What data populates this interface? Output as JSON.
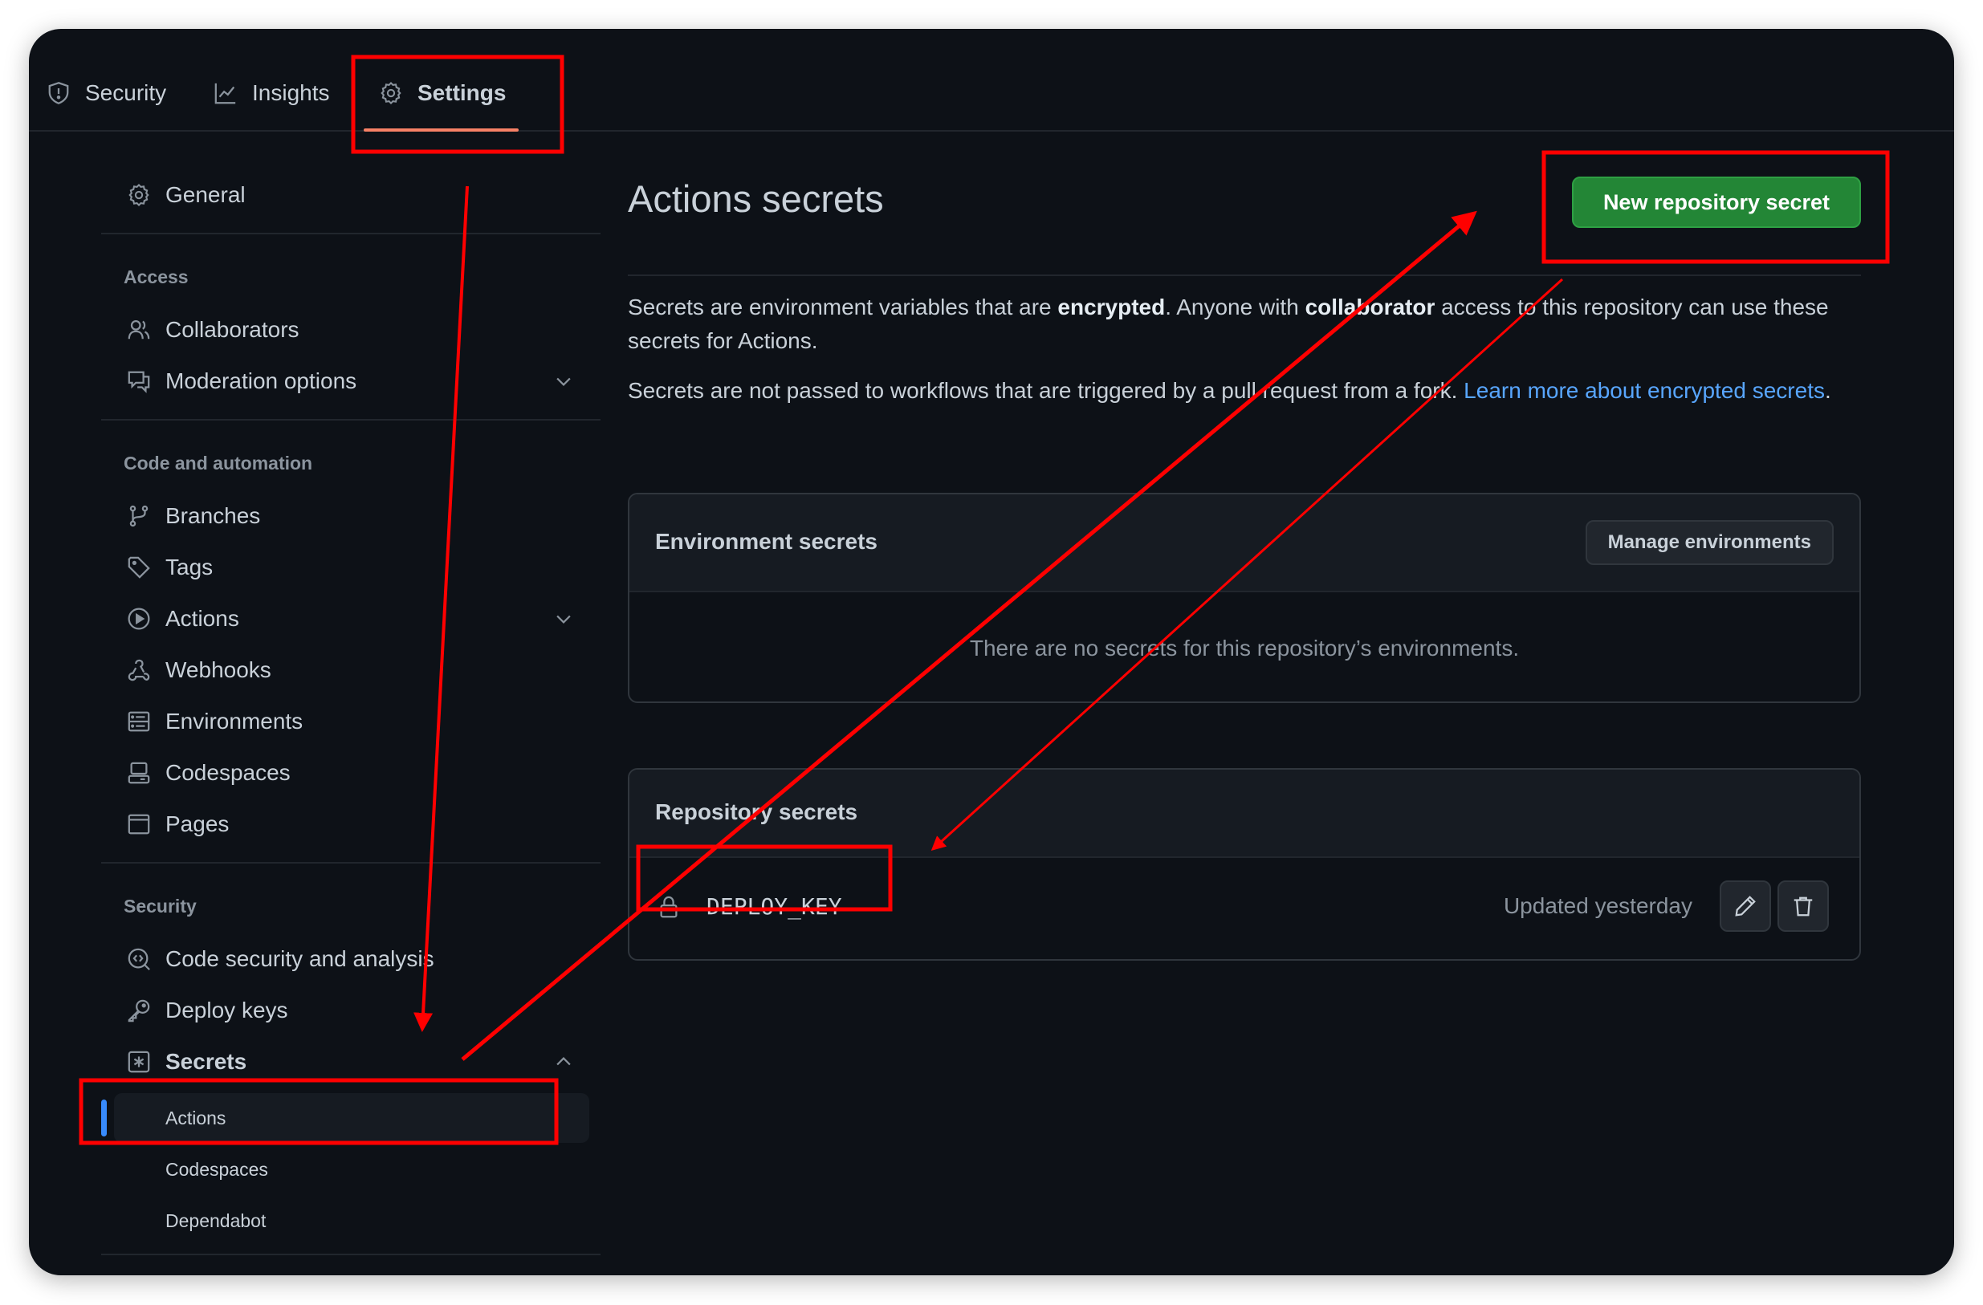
{
  "tabs": [
    {
      "label": "Security",
      "icon": "shield-icon",
      "active": false
    },
    {
      "label": "Insights",
      "icon": "graph-icon",
      "active": false
    },
    {
      "label": "Settings",
      "icon": "gear-icon",
      "active": true
    }
  ],
  "sidebar": {
    "general": {
      "label": "General",
      "icon": "gear-icon"
    },
    "sections": [
      {
        "label": "Access",
        "items": [
          {
            "label": "Collaborators",
            "icon": "people-icon"
          },
          {
            "label": "Moderation options",
            "icon": "report-icon",
            "expandable": true,
            "expanded": false
          }
        ]
      },
      {
        "label": "Code and automation",
        "items": [
          {
            "label": "Branches",
            "icon": "git-branch-icon"
          },
          {
            "label": "Tags",
            "icon": "tag-icon"
          },
          {
            "label": "Actions",
            "icon": "play-icon",
            "expandable": true,
            "expanded": false
          },
          {
            "label": "Webhooks",
            "icon": "webhook-icon"
          },
          {
            "label": "Environments",
            "icon": "server-icon"
          },
          {
            "label": "Codespaces",
            "icon": "codespaces-icon"
          },
          {
            "label": "Pages",
            "icon": "browser-icon"
          }
        ]
      },
      {
        "label": "Security",
        "items": [
          {
            "label": "Code security and analysis",
            "icon": "codescan-icon"
          },
          {
            "label": "Deploy keys",
            "icon": "key-icon"
          },
          {
            "label": "Secrets",
            "icon": "asterisk-icon",
            "expandable": true,
            "expanded": true,
            "children": [
              {
                "label": "Actions",
                "active": true
              },
              {
                "label": "Codespaces",
                "active": false
              },
              {
                "label": "Dependabot",
                "active": false
              }
            ]
          }
        ]
      }
    ]
  },
  "main": {
    "title": "Actions secrets",
    "new_secret_button": "New repository secret",
    "description": {
      "p1_a": "Secrets are environment variables that are ",
      "p1_b": "encrypted",
      "p1_c": ". Anyone with ",
      "p1_d": "collaborator",
      "p1_e": " access to this repository can use these secrets for Actions.",
      "p2_a": "Secrets are not passed to workflows that are triggered by a pull request from a fork. ",
      "p2_link": "Learn more about encrypted secrets",
      "p2_b": "."
    },
    "environment_secrets": {
      "title": "Environment secrets",
      "manage_button": "Manage environments",
      "empty_message": "There are no secrets for this repository’s environments."
    },
    "repository_secrets": {
      "title": "Repository secrets",
      "items": [
        {
          "name": "DEPLOY_KEY",
          "updated": "Updated yesterday",
          "icon": "lock-icon"
        }
      ]
    }
  },
  "annotations": {
    "color": "#ff0000"
  }
}
